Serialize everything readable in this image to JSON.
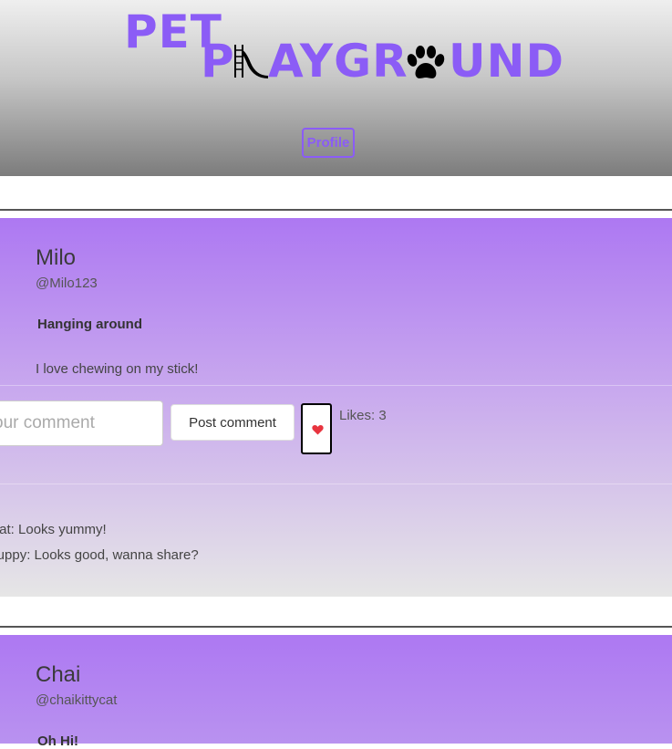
{
  "header": {
    "logo_pet": "PET",
    "logo_pl": "P",
    "logo_aygr": "AYGR",
    "logo_und": "UND",
    "profile_label": "Profile",
    "brand_color": "#8b5cf6"
  },
  "posts": [
    {
      "name": "Milo",
      "handle": "@Milo123",
      "title": "Hanging around",
      "body": "I love chewing on my stick!",
      "comment_placeholder": "our comment",
      "post_button": "Post comment",
      "likes": "Likes: 3",
      "comments": [
        "tycat: Looks yummy!",
        "apuppy: Looks good, wanna share?"
      ]
    },
    {
      "name": "Chai",
      "handle": "@chaikittycat",
      "title": "Oh Hi!"
    }
  ],
  "icons": {
    "slide": "slide-icon",
    "paw": "paw-icon",
    "heart": "heart-icon"
  }
}
